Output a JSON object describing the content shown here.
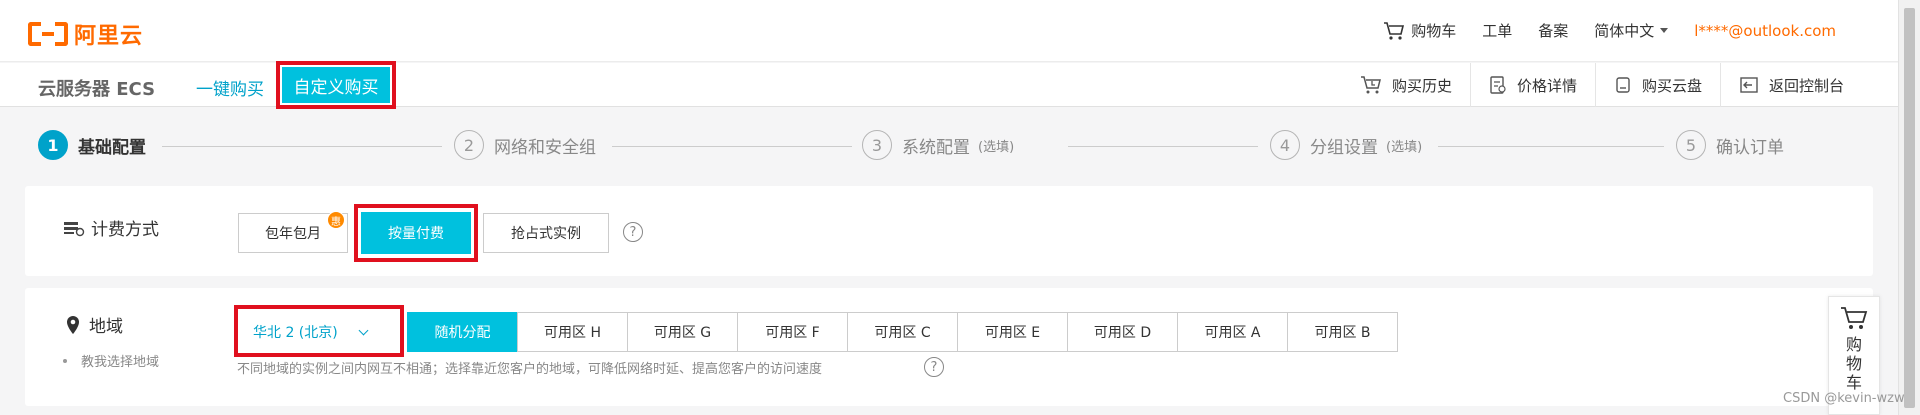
{
  "header": {
    "logo_text": "阿里云",
    "cart": "购物车",
    "ticket": "工单",
    "beian": "备案",
    "language": "简体中文",
    "email": "l****@outlook.com"
  },
  "nav": {
    "product": "云服务器 ECS",
    "tab_quick": "一键购买",
    "tab_custom": "自定义购买",
    "actions": [
      "购买历史",
      "价格详情",
      "购买云盘",
      "返回控制台"
    ]
  },
  "steps": [
    {
      "num": "1",
      "label": "基础配置",
      "optional": ""
    },
    {
      "num": "2",
      "label": "网络和安全组",
      "optional": ""
    },
    {
      "num": "3",
      "label": "系统配置",
      "optional": "(选填)"
    },
    {
      "num": "4",
      "label": "分组设置",
      "optional": "(选填)"
    },
    {
      "num": "5",
      "label": "确认订单",
      "optional": ""
    }
  ],
  "billing": {
    "label": "计费方式",
    "options": [
      "包年包月",
      "按量付费",
      "抢占式实例"
    ],
    "selected": "按量付费",
    "badge": "惠",
    "help": "?"
  },
  "region": {
    "label": "地域",
    "help_link": "教我选择地域",
    "selected_region": "华北 2 (北京)",
    "zones": [
      "随机分配",
      "可用区 H",
      "可用区 G",
      "可用区 F",
      "可用区 C",
      "可用区 E",
      "可用区 D",
      "可用区 A",
      "可用区 B"
    ],
    "selected_zone": "随机分配",
    "description": "不同地域的实例之间内网互不相通；选择靠近您客户的地域，可降低网络时延、提高您客户的访问速度",
    "help": "?"
  },
  "float_cart": {
    "label": "购物车"
  },
  "watermark": "CSDN @kevin-wzw",
  "colors": {
    "brand": "#ff6a00",
    "accent": "#00c1de",
    "highlight_box": "#e0101e"
  }
}
